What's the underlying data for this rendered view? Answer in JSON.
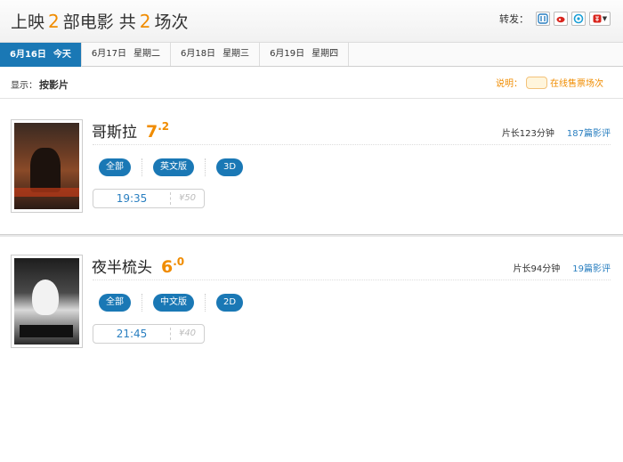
{
  "header": {
    "title_prefix": "上映",
    "movie_count": "2",
    "title_mid": "部电影 共",
    "show_count": "2",
    "title_suffix": "场次",
    "share_label": "转发：",
    "share_icons": [
      "sina-weibo-icon",
      "tencent-weibo-icon",
      "qzone-icon",
      "more-share-icon"
    ]
  },
  "tabs": [
    {
      "date": "6月16日",
      "weekday": "今天",
      "active": true
    },
    {
      "date": "6月17日",
      "weekday": "星期二",
      "active": false
    },
    {
      "date": "6月18日",
      "weekday": "星期三",
      "active": false
    },
    {
      "date": "6月19日",
      "weekday": "星期四",
      "active": false
    }
  ],
  "filter": {
    "label": "显示：",
    "value": "按影片",
    "legend_label": "说明：",
    "legend_text": "在线售票场次"
  },
  "movies": [
    {
      "title": "哥斯拉",
      "score_int": "7",
      "score_dec": ".2",
      "duration": "片长123分钟",
      "reviews": "187篇影评",
      "chips": [
        "全部",
        "英文版",
        "3D"
      ],
      "session_time": "19:35",
      "session_price": "¥50"
    },
    {
      "title": "夜半梳头",
      "score_int": "6",
      "score_dec": ".0",
      "duration": "片长94分钟",
      "reviews": "19篇影评",
      "chips": [
        "全部",
        "中文版",
        "2D"
      ],
      "session_time": "21:45",
      "session_price": "¥40"
    }
  ],
  "colors": {
    "accent": "#1a78b5",
    "highlight": "#f08c00",
    "link": "#2a7fc0"
  }
}
